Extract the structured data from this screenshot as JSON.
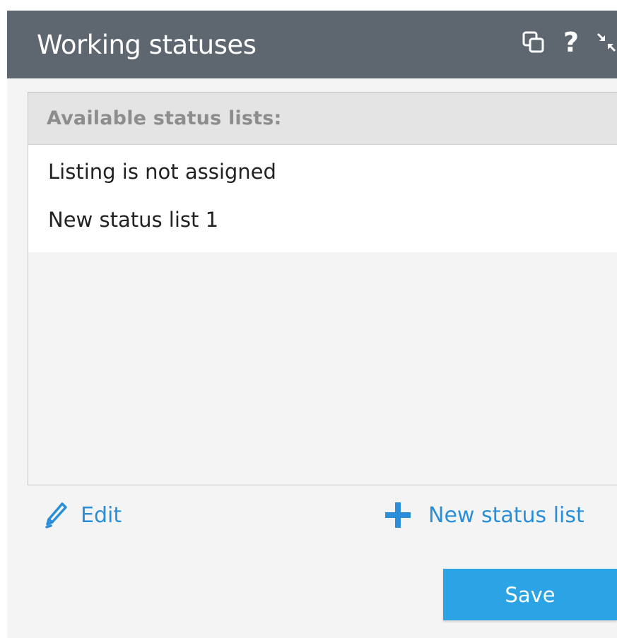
{
  "dialog": {
    "title": "Working statuses",
    "header_icons": [
      "copy-icon",
      "help-icon",
      "collapse-icon"
    ],
    "help_glyph": "?"
  },
  "status_lists": {
    "header": "Available status lists:",
    "items": [
      "Listing is not assigned",
      "New status list 1"
    ]
  },
  "actions": {
    "edit_label": "Edit",
    "new_label": "New status list"
  },
  "footer": {
    "save_label": "Save"
  },
  "colors": {
    "titlebar": "#5e6770",
    "accent": "#2a8fd8",
    "save_button": "#2ba3e4",
    "panel_bg": "#f4f4f4"
  }
}
